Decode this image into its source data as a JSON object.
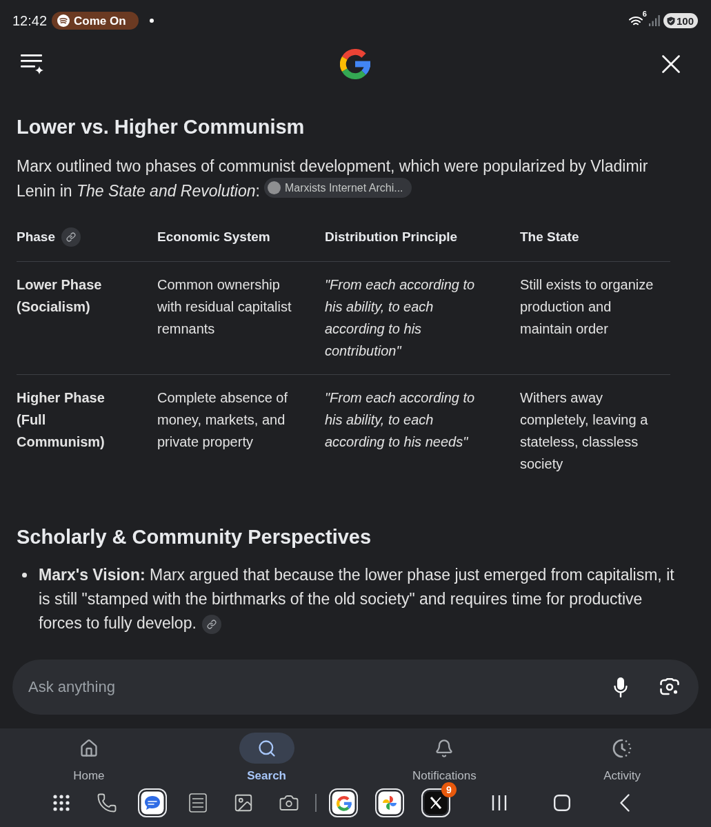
{
  "status_bar": {
    "time": "12:42",
    "media_chip": "Come On",
    "wifi_label": "6",
    "battery": "100"
  },
  "section": {
    "heading": "Lower vs. Higher Communism",
    "intro": "Marx outlined two phases of communist development, which were popularized by Vladimir Lenin in *The State and Revolution*:",
    "source_chip": "Marxists Internet Archi..."
  },
  "table": {
    "columns": [
      {
        "label": "Phase",
        "kind": "label",
        "citation": true
      },
      {
        "label": "Economic System",
        "kind": "text",
        "citation": false
      },
      {
        "label": "Distribution Principle",
        "kind": "quote",
        "citation": false
      },
      {
        "label": "The State",
        "kind": "text",
        "citation": false
      }
    ],
    "rows": [
      {
        "cells": [
          "Lower Phase (Socialism)",
          "Common ownership with residual capitalist remnants",
          "\"From each according to his ability, to each according to his contribution\"",
          "Still exists to organize production and maintain order"
        ]
      },
      {
        "cells": [
          "Higher Phase (Full Communism)",
          "Complete absence of money, markets, and private property",
          "\"From each according to his ability, to each according to his needs\"",
          "Withers away completely, leaving a stateless, classless society"
        ]
      }
    ]
  },
  "section_2": {
    "heading": "Scholarly & Community Perspectives",
    "bullets": [
      {
        "text": "**Marx's Vision:** Marx argued that because the lower phase just emerged from capitalism, it is still \"stamped with the birthmarks of the old society\" and requires time for productive forces to fully develop.",
        "citation": true
      }
    ]
  },
  "ask_field": {
    "placeholder": "Ask anything"
  },
  "bottom_nav": [
    {
      "label": "Home",
      "kind": "home",
      "selected": false
    },
    {
      "label": "Search",
      "kind": "search",
      "selected": true
    },
    {
      "label": "Notifications",
      "kind": "bell",
      "selected": false
    },
    {
      "label": "Activity",
      "kind": "activity",
      "selected": false
    }
  ],
  "taskbar": {
    "pinned": [
      {
        "kind": "apps"
      },
      {
        "kind": "phone"
      },
      {
        "kind": "messages"
      },
      {
        "kind": "notes"
      },
      {
        "kind": "gallery"
      },
      {
        "kind": "camera"
      }
    ],
    "recent": [
      {
        "kind": "google"
      },
      {
        "kind": "photos"
      },
      {
        "kind": "x",
        "badge": "9"
      }
    ]
  }
}
